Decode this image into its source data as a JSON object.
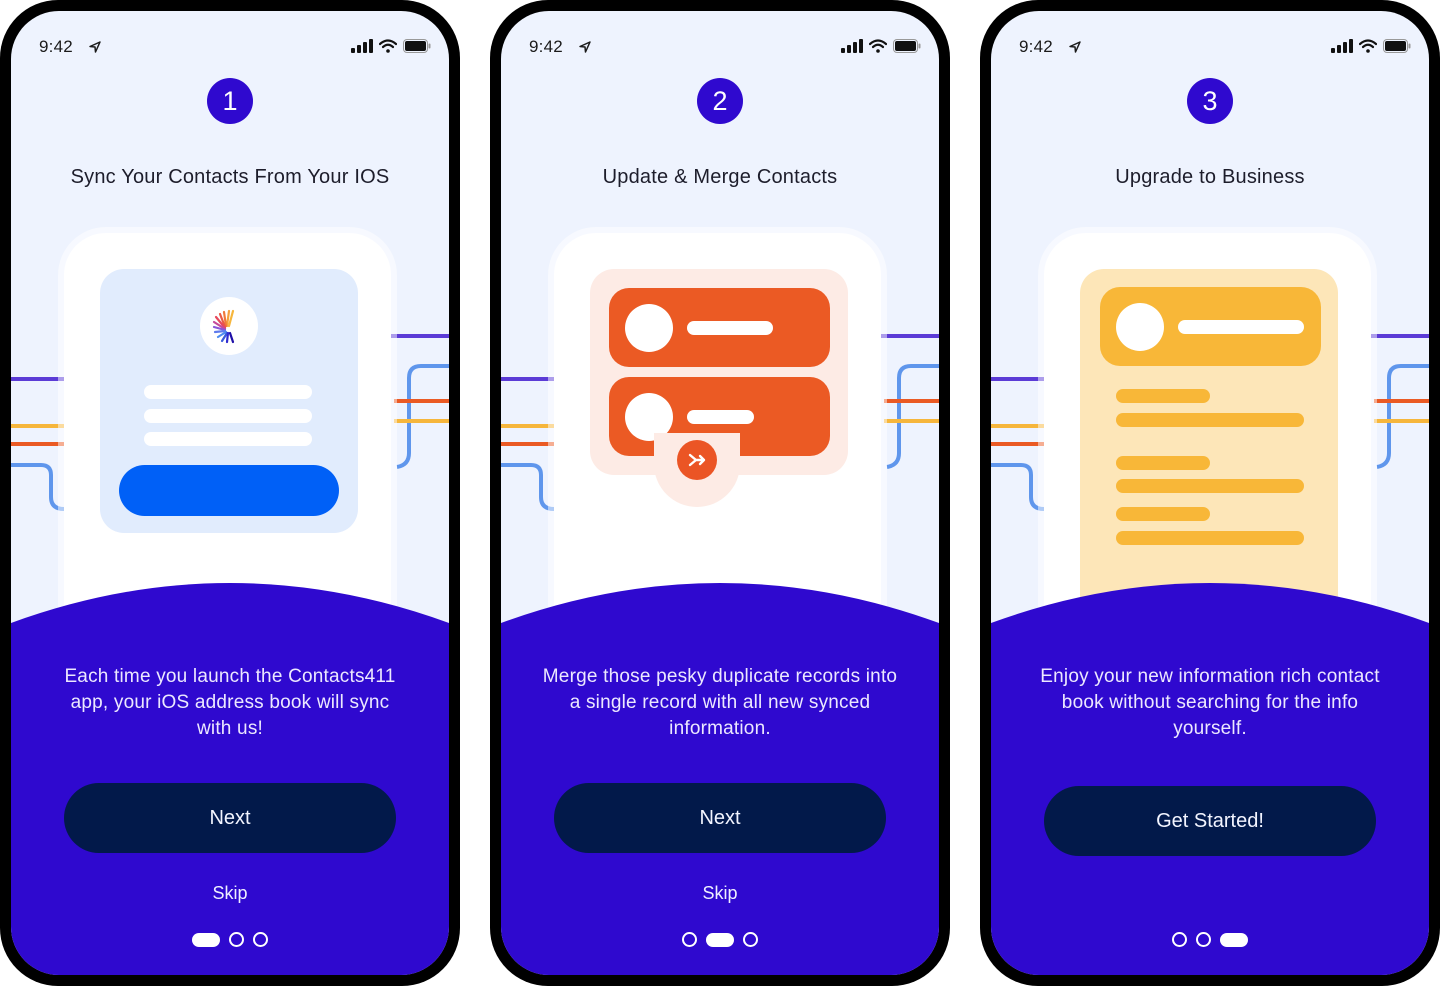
{
  "colors": {
    "brand_purple": "#2f09cf",
    "screen_bg": "#eef3fe",
    "button_navy": "#02194a",
    "orange": "#eb5a24",
    "yellow": "#f8b738",
    "blue": "#0060f7"
  },
  "status_bar": {
    "time": "9:42",
    "icons": [
      "location-arrow-icon",
      "cellular-signal-icon",
      "wifi-icon",
      "battery-icon"
    ]
  },
  "screens": [
    {
      "step": "1",
      "title": "Sync Your Contacts From Your IOS",
      "illustration": "sync-card-with-logo",
      "description": "Each time you launch the Contacts411 app, your iOS address book will sync with us!",
      "primary_button": "Next",
      "skip_label": "Skip",
      "page_indicator": {
        "current": 1,
        "total": 3
      }
    },
    {
      "step": "2",
      "title": "Update & Merge Contacts",
      "illustration": "merge-contact-cards",
      "description": "Merge those pesky duplicate records into a single record with all new synced information.",
      "primary_button": "Next",
      "skip_label": "Skip",
      "page_indicator": {
        "current": 2,
        "total": 3
      }
    },
    {
      "step": "3",
      "title": "Upgrade to Business",
      "illustration": "business-contact-profile",
      "description": "Enjoy your new information rich contact book without searching for the info yourself.",
      "primary_button": "Get Started!",
      "skip_label": null,
      "page_indicator": {
        "current": 3,
        "total": 3
      }
    }
  ]
}
